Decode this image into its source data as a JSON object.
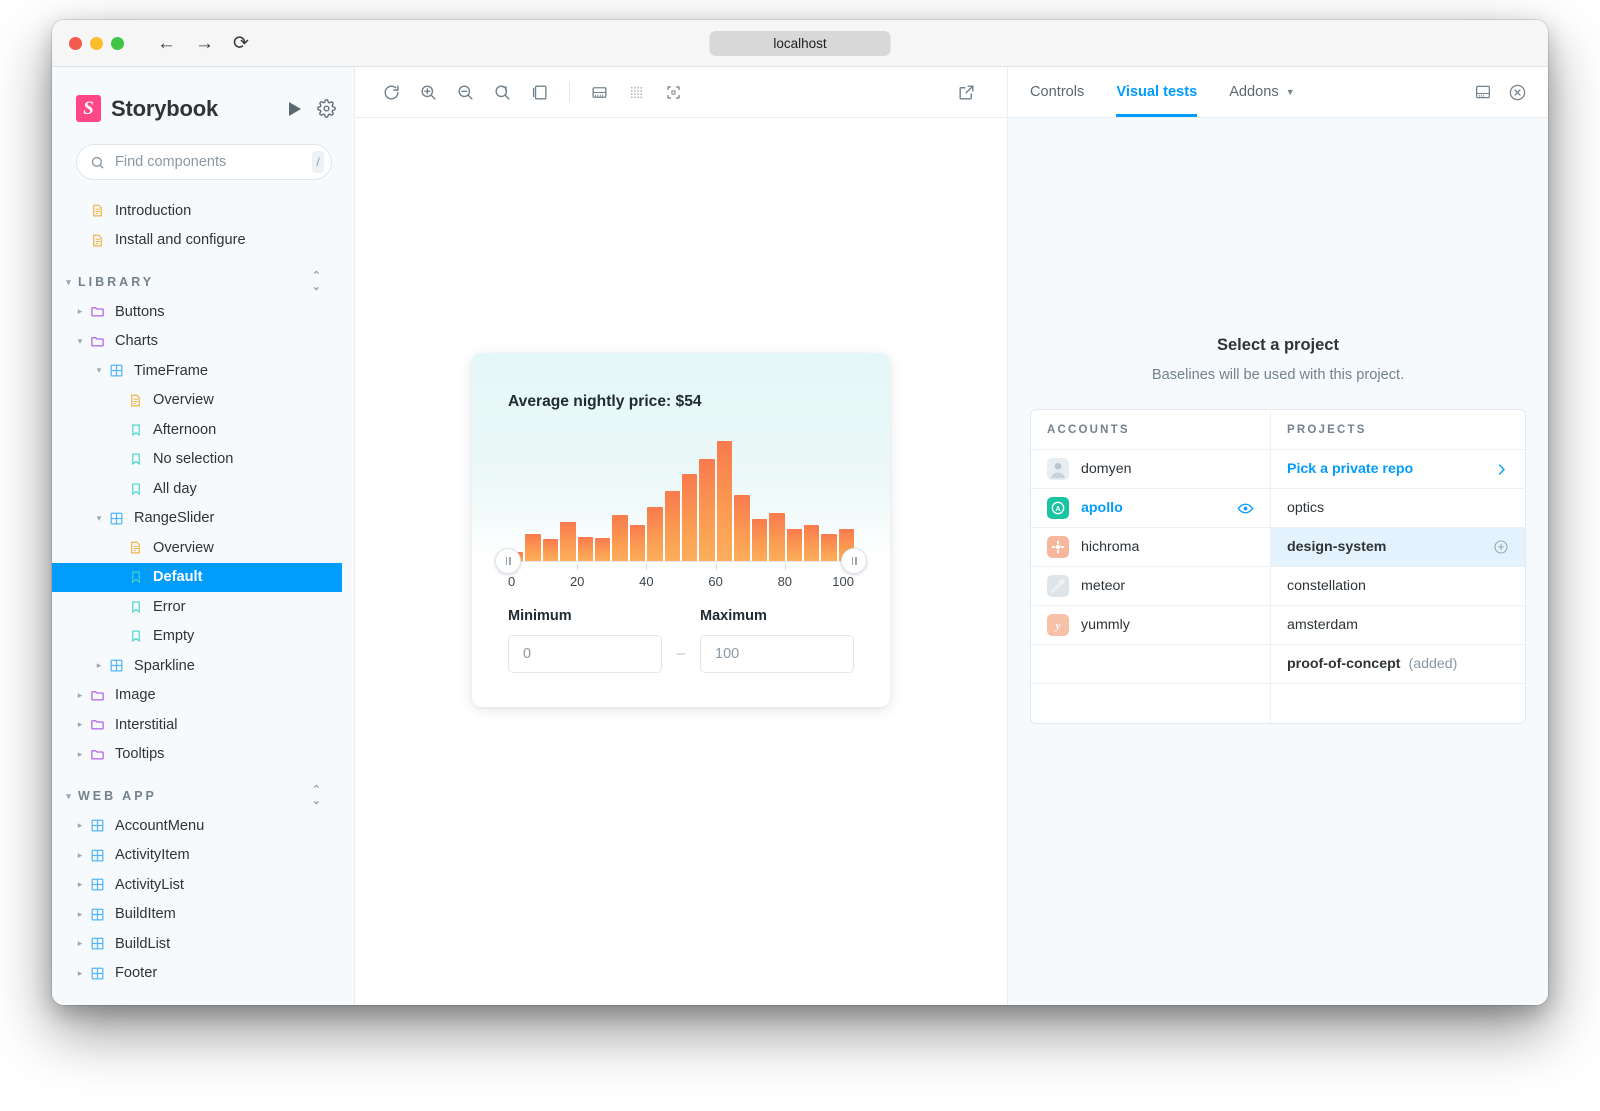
{
  "browser": {
    "address": "localhost",
    "back_icon": "←",
    "forward_icon": "→",
    "reload_icon": "⟳"
  },
  "sidebar": {
    "brand": "Storybook",
    "logo_letter": "S",
    "play_label": "play-button",
    "settings_label": "settings",
    "search": {
      "placeholder": "Find components",
      "value": "",
      "shortcut": "/"
    },
    "top_items": [
      {
        "label": "Introduction",
        "icon": "document-icon"
      },
      {
        "label": "Install and configure",
        "icon": "document-icon"
      }
    ],
    "groups": [
      {
        "label": "LIBRARY",
        "items": [
          {
            "label": "Buttons",
            "icon": "folder-icon",
            "depth": 0,
            "caret": "right"
          },
          {
            "label": "Charts",
            "icon": "folder-icon",
            "depth": 0,
            "caret": "down"
          },
          {
            "label": "TimeFrame",
            "icon": "component-icon",
            "depth": 1,
            "caret": "down"
          },
          {
            "label": "Overview",
            "icon": "document-icon",
            "depth": 2,
            "caret": "none"
          },
          {
            "label": "Afternoon",
            "icon": "story-icon",
            "depth": 2,
            "caret": "none"
          },
          {
            "label": "No selection",
            "icon": "story-icon",
            "depth": 2,
            "caret": "none"
          },
          {
            "label": "All day",
            "icon": "story-icon",
            "depth": 2,
            "caret": "none"
          },
          {
            "label": "RangeSlider",
            "icon": "component-icon",
            "depth": 1,
            "caret": "down"
          },
          {
            "label": "Overview",
            "icon": "document-icon",
            "depth": 2,
            "caret": "none"
          },
          {
            "label": "Default",
            "icon": "story-icon",
            "depth": 2,
            "caret": "none",
            "selected": true
          },
          {
            "label": "Error",
            "icon": "story-icon",
            "depth": 2,
            "caret": "none"
          },
          {
            "label": "Empty",
            "icon": "story-icon",
            "depth": 2,
            "caret": "none"
          },
          {
            "label": "Sparkline",
            "icon": "component-icon",
            "depth": 1,
            "caret": "right"
          },
          {
            "label": "Image",
            "icon": "folder-icon",
            "depth": 0,
            "caret": "right"
          },
          {
            "label": "Interstitial",
            "icon": "folder-icon",
            "depth": 0,
            "caret": "right"
          },
          {
            "label": "Tooltips",
            "icon": "folder-icon",
            "depth": 0,
            "caret": "right"
          }
        ]
      },
      {
        "label": "WEB APP",
        "items": [
          {
            "label": "AccountMenu",
            "icon": "component-icon",
            "depth": 0,
            "caret": "right"
          },
          {
            "label": "ActivityItem",
            "icon": "component-icon",
            "depth": 0,
            "caret": "right"
          },
          {
            "label": "ActivityList",
            "icon": "component-icon",
            "depth": 0,
            "caret": "right"
          },
          {
            "label": "BuildItem",
            "icon": "component-icon",
            "depth": 0,
            "caret": "right"
          },
          {
            "label": "BuildList",
            "icon": "component-icon",
            "depth": 0,
            "caret": "right"
          },
          {
            "label": "Footer",
            "icon": "component-icon",
            "depth": 0,
            "caret": "right"
          }
        ]
      }
    ]
  },
  "toolbar": {
    "buttons": [
      {
        "name": "remount-icon"
      },
      {
        "name": "zoom-in-icon"
      },
      {
        "name": "zoom-out-icon"
      },
      {
        "name": "zoom-reset-icon"
      },
      {
        "name": "background-icon"
      },
      {
        "name": "measure-icon"
      },
      {
        "name": "grid-icon"
      },
      {
        "name": "outline-icon"
      }
    ],
    "open_new_tab": "open-in-new-tab-icon"
  },
  "story": {
    "title": "Average nightly price: $54",
    "minimum_label": "Minimum",
    "maximum_label": "Maximum",
    "minimum_value": "0",
    "maximum_value": "100",
    "separator": "–"
  },
  "chart_data": {
    "type": "bar",
    "title": "Average nightly price: $54",
    "xlabel": "",
    "ylabel": "",
    "xlim": [
      0,
      100
    ],
    "ylim": [
      0,
      100
    ],
    "grid": false,
    "legend": null,
    "tick_labels": [
      "0",
      "20",
      "40",
      "60",
      "80",
      "100"
    ],
    "tick_values": [
      0,
      20,
      40,
      60,
      80,
      100
    ],
    "bin_width": 5,
    "x": [
      2.5,
      7.5,
      12.5,
      17.5,
      22.5,
      27.5,
      32.5,
      37.5,
      42.5,
      47.5,
      52.5,
      57.5,
      62.5,
      67.5,
      72.5,
      77.5,
      82.5,
      87.5,
      92.5,
      97.5
    ],
    "values": [
      7,
      22,
      18,
      32,
      20,
      19,
      38,
      30,
      45,
      58,
      72,
      85,
      100,
      55,
      35,
      40,
      26,
      30,
      22,
      26
    ],
    "bar_color_top": "#f97a4d",
    "bar_color_bottom": "#fcae5c",
    "handles": {
      "min": 0,
      "max": 100
    }
  },
  "addons_panel": {
    "tabs": [
      {
        "label": "Controls",
        "active": false
      },
      {
        "label": "Visual tests",
        "active": true
      },
      {
        "label": "Addons",
        "active": false,
        "has_caret": true
      }
    ],
    "panel_position_icon": "panel-position-icon",
    "close_icon": "close-icon",
    "heading": "Select a project",
    "subheading": "Baselines will be used with this project.",
    "table": {
      "headers": [
        "ACCOUNTS",
        "PROJECTS"
      ],
      "accounts": [
        {
          "name": "domyen",
          "avatar": "av-domyen",
          "avatar_letter": "",
          "selected": false
        },
        {
          "name": "apollo",
          "avatar": "av-apollo",
          "avatar_letter": "A",
          "selected": true,
          "eye_icon": "eye-icon"
        },
        {
          "name": "hichroma",
          "avatar": "av-hichroma",
          "avatar_letter": "",
          "selected": false
        },
        {
          "name": "meteor",
          "avatar": "av-meteor",
          "avatar_letter": "",
          "selected": false
        },
        {
          "name": "yummly",
          "avatar": "av-yummly",
          "avatar_letter": "y",
          "selected": false
        }
      ],
      "projects": [
        {
          "name": "Pick a private repo",
          "style": "link",
          "end_icon": "chevron-right-icon"
        },
        {
          "name": "optics",
          "style": "normal"
        },
        {
          "name": "design-system",
          "style": "bold",
          "highlighted": true,
          "end_icon": "plus-circle-icon"
        },
        {
          "name": "constellation",
          "style": "normal"
        },
        {
          "name": "amsterdam",
          "style": "normal"
        },
        {
          "name": "proof-of-concept",
          "style": "bold",
          "suffix": "(added)"
        }
      ]
    }
  },
  "colors": {
    "accent": "#029cfd",
    "brand_pink": "#ff4785",
    "sidebar_bg": "#f7fafc",
    "bar_orange": "#f97a4d",
    "highlight_row": "#e3f2fd"
  }
}
